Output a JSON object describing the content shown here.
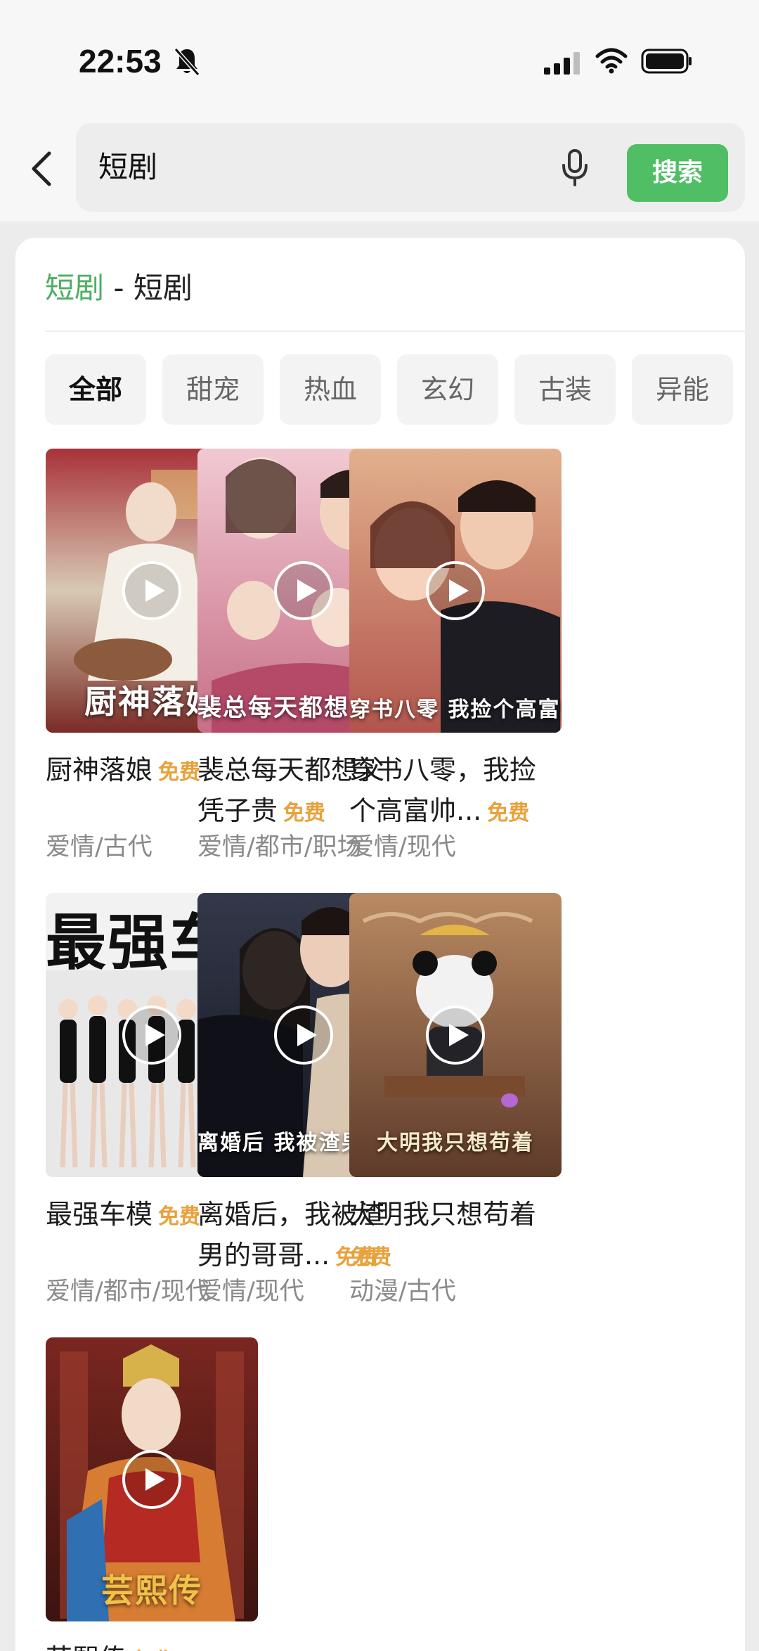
{
  "status_bar": {
    "time": "22:53"
  },
  "search": {
    "query": "短剧",
    "button_label": "搜索"
  },
  "results": {
    "keyword": "短剧",
    "separator": "-",
    "category": "短剧",
    "filters": [
      "全部",
      "甜宠",
      "热血",
      "玄幻",
      "古装",
      "异能"
    ],
    "active_filter": "全部",
    "items": [
      {
        "title": "厨神落娘",
        "badge": "免费",
        "genre": "爱情/古代",
        "caption": "厨神落娘"
      },
      {
        "title": "裴总每天都想父凭子贵",
        "badge": "免费",
        "genre": "爱情/都市/职场",
        "caption": "裴总每天都想父凭子贵"
      },
      {
        "title": "穿书八零，我捡个高富帅...",
        "badge": "免费",
        "genre": "爱情/现代",
        "caption": "穿书八零 我捡个高富帅老公"
      },
      {
        "title": "最强车模",
        "badge": "免费",
        "genre": "爱情/都市/现代",
        "caption": "最强车模"
      },
      {
        "title": "离婚后，我被渣男的哥哥...",
        "badge": "免费",
        "genre": "爱情/现代",
        "caption": "离婚后 我被渣男的哥哥宠上天"
      },
      {
        "title": "大明我只想苟着",
        "badge": "免费",
        "genre": "动漫/古代",
        "caption": "大明我只想苟着"
      },
      {
        "title": "芸熙传",
        "badge": "免费",
        "genre": "",
        "caption": "芸熙传"
      }
    ]
  },
  "colors": {
    "accent_green": "#4fbe64",
    "keyword_green": "#4fae63",
    "free_orange": "#e8a13b"
  },
  "icons": {
    "back": "chevron-left-icon",
    "mic": "microphone-icon",
    "play": "play-icon",
    "bell": "bell-slash-icon",
    "signal": "signal-icon",
    "wifi": "wifi-icon",
    "battery": "battery-icon"
  }
}
